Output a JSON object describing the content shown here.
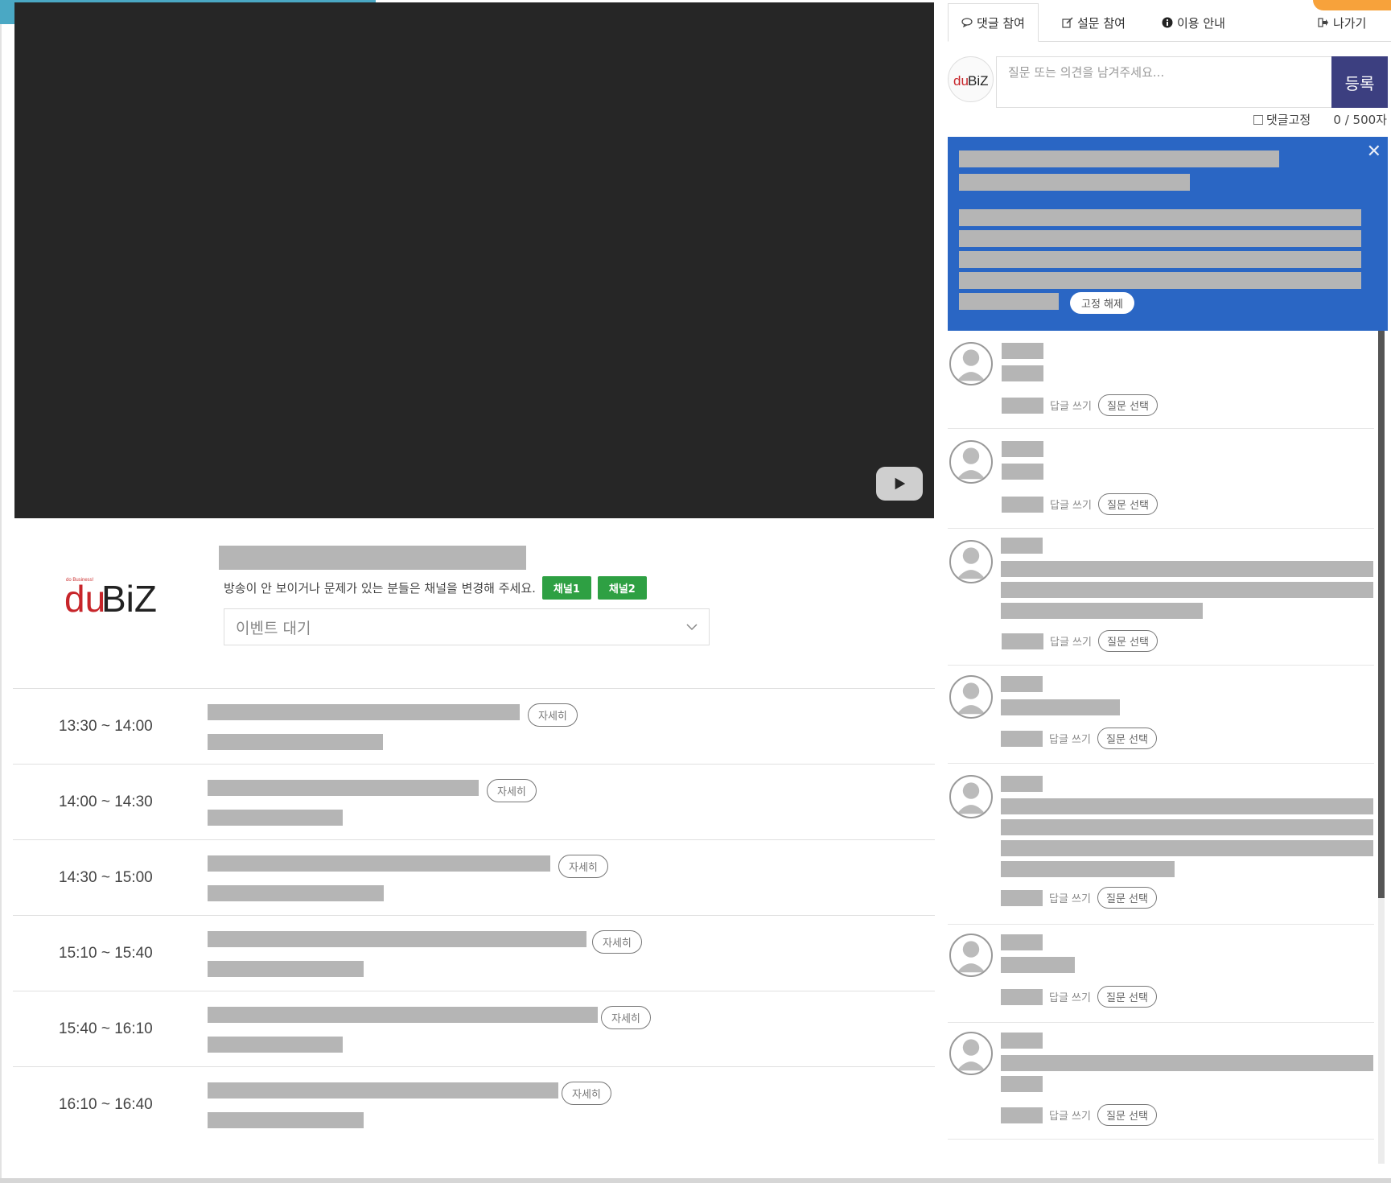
{
  "video": {
    "play_icon": "youtube-play-icon"
  },
  "event": {
    "logo_text": "duBiZ",
    "logo_tagline": "do Business!",
    "notice": "방송이 안 보이거나 문제가 있는 분들은 채널을 변경해 주세요.",
    "channels": [
      "채널1",
      "채널2"
    ],
    "status_select_value": "이벤트 대기"
  },
  "schedule": [
    {
      "time": "13:30 ~ 14:00",
      "detail_label": "자세히"
    },
    {
      "time": "14:00 ~ 14:30",
      "detail_label": "자세히"
    },
    {
      "time": "14:30 ~ 15:00",
      "detail_label": "자세히"
    },
    {
      "time": "15:10 ~ 15:40",
      "detail_label": "자세히"
    },
    {
      "time": "15:40 ~ 16:10",
      "detail_label": "자세히"
    },
    {
      "time": "16:10 ~ 16:40",
      "detail_label": "자세히"
    }
  ],
  "tabs": {
    "comment": "댓글 참여",
    "survey": "설문 참여",
    "guide": "이용 안내",
    "exit": "나가기"
  },
  "comment_form": {
    "avatar_logo": "duBiZ",
    "placeholder": "질문 또는 의견을 남겨주세요...",
    "submit_label": "등록",
    "pin_label": "댓글고정",
    "char_count": "0 / 500자"
  },
  "pinned": {
    "close_icon": "close-icon",
    "unpin_label": "고정 해제"
  },
  "comment_actions": {
    "reply_label": "답글 쓰기",
    "select_label": "질문 선택"
  },
  "colors": {
    "pinned_bg": "#2a66c4",
    "submit_bg": "#3c3f80",
    "channel_green": "#2ea043",
    "top_tab": "#4aa8c4",
    "orange_corner": "#f7a23b"
  }
}
